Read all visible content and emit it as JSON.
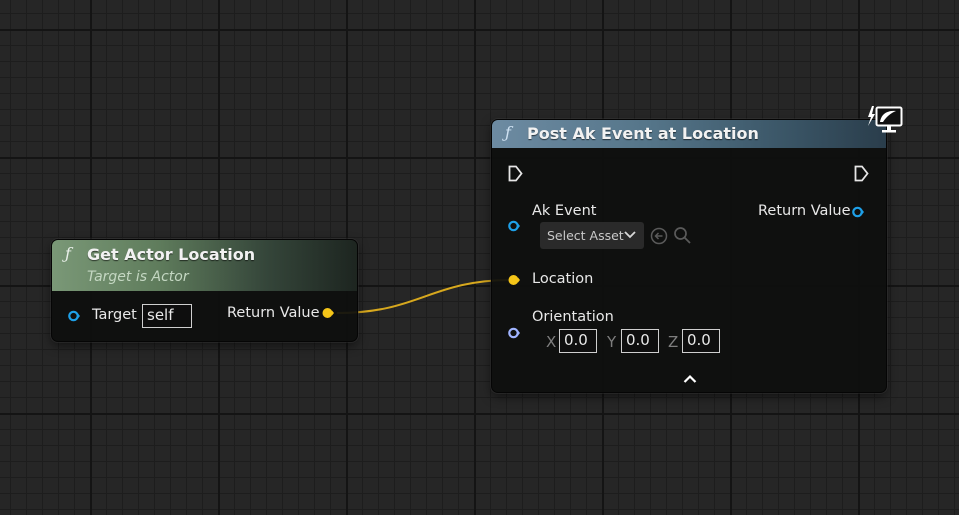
{
  "node_get_actor_location": {
    "title": "Get Actor Location",
    "subtitle": "Target is Actor",
    "target_label": "Target",
    "target_value": "self",
    "return_label": "Return Value"
  },
  "node_post_ak_event": {
    "title": "Post Ak Event at Location",
    "ak_event_label": "Ak Event",
    "select_asset": "Select Asset",
    "return_label": "Return Value",
    "location_label": "Location",
    "orientation_label": "Orientation",
    "x_label": "X",
    "x_value": "0.0",
    "y_label": "Y",
    "y_value": "0.0",
    "z_label": "Z",
    "z_value": "0.0"
  },
  "colors": {
    "object_pin": "#1ea0e8",
    "vector_pin": "#f5c518",
    "rotator_pin": "#a0b4ff",
    "pure_header": "#6a8a66",
    "function_header": "#5f7f94"
  }
}
